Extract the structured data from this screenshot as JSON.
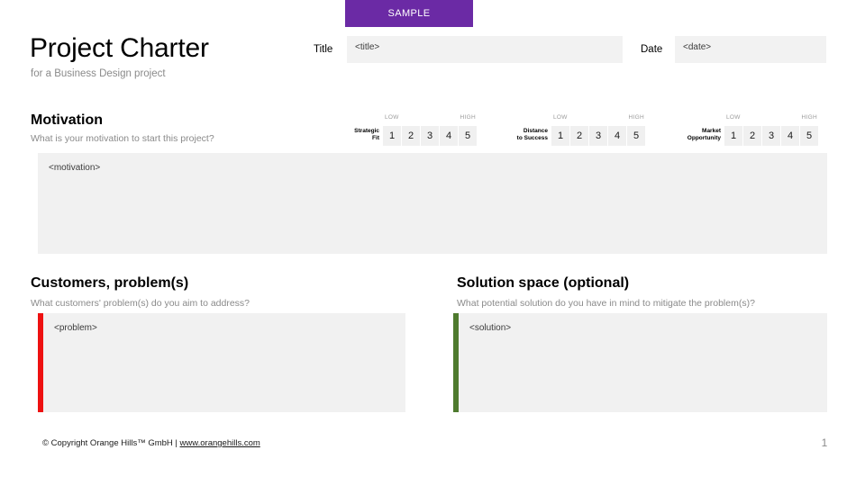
{
  "banner": {
    "label": "SAMPLE",
    "color": "#6B2AA5"
  },
  "header": {
    "title": "Project Charter",
    "subtitle": "for a Business Design project",
    "title_field": {
      "label": "Title",
      "value": "<title>"
    },
    "date_field": {
      "label": "Date",
      "value": "<date>"
    }
  },
  "motivation": {
    "heading": "Motivation",
    "question": "What is your motivation to start this project?",
    "answer": "<motivation>",
    "scales": [
      {
        "label_line1": "Strategic",
        "label_line2": "Fit",
        "low": "LOW",
        "high": "HIGH",
        "options": [
          "1",
          "2",
          "3",
          "4",
          "5"
        ]
      },
      {
        "label_line1": "Distance",
        "label_line2": "to Success",
        "low": "LOW",
        "high": "HIGH",
        "options": [
          "1",
          "2",
          "3",
          "4",
          "5"
        ]
      },
      {
        "label_line1": "Market",
        "label_line2": "Opportunity",
        "low": "LOW",
        "high": "HIGH",
        "options": [
          "1",
          "2",
          "3",
          "4",
          "5"
        ]
      }
    ]
  },
  "problem": {
    "heading": "Customers‚ problem(s)",
    "question": "What customers' problem(s) do you aim to address?",
    "answer": "<problem>",
    "accent_color": "#EE1111"
  },
  "solution": {
    "heading": "Solution space (optional)",
    "question": "What potential solution do you have in mind to mitigate the problem(s)?",
    "answer": "<solution>",
    "accent_color": "#4E7A2E"
  },
  "footer": {
    "copyright_prefix": "© Copyright Orange Hills™ GmbH | ",
    "url": "www.orangehills.com",
    "page_number": "1"
  }
}
